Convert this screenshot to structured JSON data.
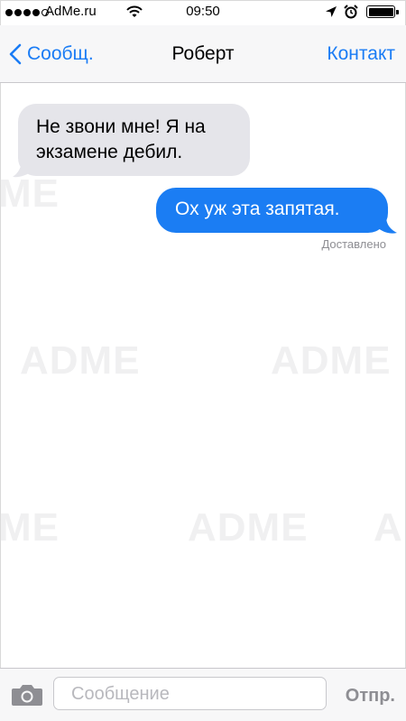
{
  "status_bar": {
    "carrier": "AdMe.ru",
    "time": "09:50",
    "signal_bars_filled": 4,
    "signal_bars_total": 5,
    "icons": [
      "signal-dots",
      "wifi-icon",
      "location-icon",
      "alarm-icon",
      "battery-icon"
    ]
  },
  "nav": {
    "back_label": "Сообщ.",
    "title": "Роберт",
    "contact_label": "Контакт"
  },
  "messages": [
    {
      "direction": "incoming",
      "text": "Не звони мне! Я на экзамене дебил."
    },
    {
      "direction": "outgoing",
      "text": "Ох уж эта запятая."
    }
  ],
  "delivery_status": "Доставлено",
  "watermark": "ADME",
  "composer": {
    "placeholder": "Сообщение",
    "send_label": "Отпр."
  },
  "colors": {
    "accent": "#1a7cf5",
    "outgoing_bubble": "#1b7df3",
    "incoming_bubble": "#e5e5ea"
  }
}
